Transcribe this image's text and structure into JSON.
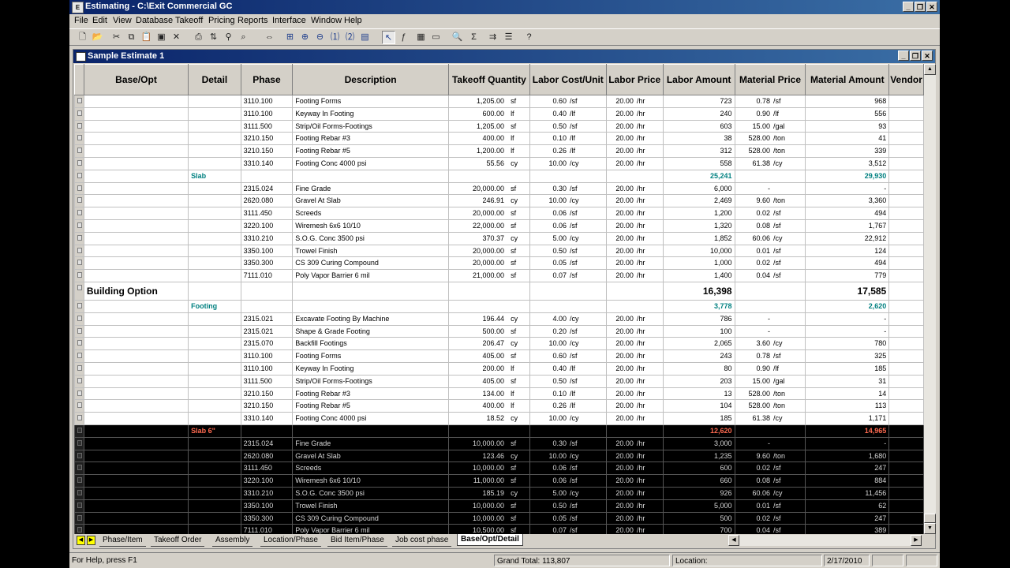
{
  "app": {
    "title": "Estimating - C:\\Exit Commercial GC",
    "icon_text": "E"
  },
  "window_buttons": {
    "minimize": "_",
    "restore": "❐",
    "close": "✕"
  },
  "menu": [
    "File",
    "Edit",
    "View",
    "Database",
    "Takeoff",
    "Pricing",
    "Reports",
    "Interface",
    "Window",
    "Help"
  ],
  "toolbar_icons": [
    "new-file-icon",
    "open-folder-icon",
    "cut-icon",
    "copy-icon",
    "paste-icon",
    "paste-special-icon",
    "delete-icon",
    "print-icon",
    "sort-icon",
    "filter-icon",
    "find-icon",
    "column-resize-icon",
    "insert-icon",
    "expand-icon",
    "collapse-icon",
    "level-1-icon",
    "level-2-icon",
    "totals-icon",
    "select-icon",
    "formula-icon",
    "grid-icon",
    "spreadsheet-icon",
    "zoom-icon",
    "sum-icon",
    "goto-icon",
    "sort-levels-icon",
    "help-pointer-icon"
  ],
  "document": {
    "title": "Sample Estimate 1"
  },
  "columns": [
    "",
    "Base/Opt",
    "Detail",
    "Phase",
    "Description",
    "Takeoff Quantity",
    "Labor Cost/Unit",
    "Labor Price",
    "Labor Amount",
    "Material Price",
    "Material Amount",
    "Vendor"
  ],
  "rows": [
    {
      "type": "item",
      "phase": "3110.100",
      "desc": "Footing Forms",
      "qty": "1,205.00",
      "qty_u": "sf",
      "lcu": "0.60",
      "lcu_u": "/sf",
      "lp": "20.00",
      "lp_u": "/hr",
      "la": "723",
      "mp": "0.78",
      "mp_u": "/sf",
      "ma": "968"
    },
    {
      "type": "item",
      "phase": "3110.100",
      "desc": "Keyway In Footing",
      "qty": "600.00",
      "qty_u": "lf",
      "lcu": "0.40",
      "lcu_u": "/lf",
      "lp": "20.00",
      "lp_u": "/hr",
      "la": "240",
      "mp": "0.90",
      "mp_u": "/lf",
      "ma": "556"
    },
    {
      "type": "item",
      "phase": "3111.500",
      "desc": "Strip/Oil Forms-Footings",
      "qty": "1,205.00",
      "qty_u": "sf",
      "lcu": "0.50",
      "lcu_u": "/sf",
      "lp": "20.00",
      "lp_u": "/hr",
      "la": "603",
      "mp": "15.00",
      "mp_u": "/gal",
      "ma": "93"
    },
    {
      "type": "item",
      "phase": "3210.150",
      "desc": "Footing Rebar #3",
      "qty": "400.00",
      "qty_u": "lf",
      "lcu": "0.10",
      "lcu_u": "/lf",
      "lp": "20.00",
      "lp_u": "/hr",
      "la": "38",
      "mp": "528.00",
      "mp_u": "/ton",
      "ma": "41"
    },
    {
      "type": "item",
      "phase": "3210.150",
      "desc": "Footing Rebar #5",
      "qty": "1,200.00",
      "qty_u": "lf",
      "lcu": "0.26",
      "lcu_u": "/lf",
      "lp": "20.00",
      "lp_u": "/hr",
      "la": "312",
      "mp": "528.00",
      "mp_u": "/ton",
      "ma": "339"
    },
    {
      "type": "item",
      "phase": "3310.140",
      "desc": "Footing Conc 4000 psi",
      "qty": "55.56",
      "qty_u": "cy",
      "lcu": "10.00",
      "lcu_u": "/cy",
      "lp": "20.00",
      "lp_u": "/hr",
      "la": "558",
      "mp": "61.38",
      "mp_u": "/cy",
      "ma": "3,512"
    },
    {
      "type": "group",
      "label": "Slab",
      "la": "25,241",
      "ma": "29,930"
    },
    {
      "type": "item",
      "phase": "2315.024",
      "desc": "Fine Grade",
      "qty": "20,000.00",
      "qty_u": "sf",
      "lcu": "0.30",
      "lcu_u": "/sf",
      "lp": "20.00",
      "lp_u": "/hr",
      "la": "6,000",
      "mp": "-",
      "mp_u": "",
      "ma": "-"
    },
    {
      "type": "item",
      "phase": "2620.080",
      "desc": "Gravel At Slab",
      "qty": "246.91",
      "qty_u": "cy",
      "lcu": "10.00",
      "lcu_u": "/cy",
      "lp": "20.00",
      "lp_u": "/hr",
      "la": "2,469",
      "mp": "9.60",
      "mp_u": "/ton",
      "ma": "3,360"
    },
    {
      "type": "item",
      "phase": "3111.450",
      "desc": "Screeds",
      "qty": "20,000.00",
      "qty_u": "sf",
      "lcu": "0.06",
      "lcu_u": "/sf",
      "lp": "20.00",
      "lp_u": "/hr",
      "la": "1,200",
      "mp": "0.02",
      "mp_u": "/sf",
      "ma": "494"
    },
    {
      "type": "item",
      "phase": "3220.100",
      "desc": "Wiremesh 6x6 10/10",
      "qty": "22,000.00",
      "qty_u": "sf",
      "lcu": "0.06",
      "lcu_u": "/sf",
      "lp": "20.00",
      "lp_u": "/hr",
      "la": "1,320",
      "mp": "0.08",
      "mp_u": "/sf",
      "ma": "1,767"
    },
    {
      "type": "item",
      "phase": "3310.210",
      "desc": "S.O.G. Conc 3500 psi",
      "qty": "370.37",
      "qty_u": "cy",
      "lcu": "5.00",
      "lcu_u": "/cy",
      "lp": "20.00",
      "lp_u": "/hr",
      "la": "1,852",
      "mp": "60.06",
      "mp_u": "/cy",
      "ma": "22,912"
    },
    {
      "type": "item",
      "phase": "3350.100",
      "desc": "Trowel Finish",
      "qty": "20,000.00",
      "qty_u": "sf",
      "lcu": "0.50",
      "lcu_u": "/sf",
      "lp": "20.00",
      "lp_u": "/hr",
      "la": "10,000",
      "mp": "0.01",
      "mp_u": "/sf",
      "ma": "124"
    },
    {
      "type": "item",
      "phase": "3350.300",
      "desc": "CS 309 Curing Compound",
      "qty": "20,000.00",
      "qty_u": "sf",
      "lcu": "0.05",
      "lcu_u": "/sf",
      "lp": "20.00",
      "lp_u": "/hr",
      "la": "1,000",
      "mp": "0.02",
      "mp_u": "/sf",
      "ma": "494"
    },
    {
      "type": "item",
      "phase": "7111.010",
      "desc": "Poly Vapor Barrier 6 mil",
      "qty": "21,000.00",
      "qty_u": "sf",
      "lcu": "0.07",
      "lcu_u": "/sf",
      "lp": "20.00",
      "lp_u": "/hr",
      "la": "1,400",
      "mp": "0.04",
      "mp_u": "/sf",
      "ma": "779"
    },
    {
      "type": "option",
      "label": "Building Option",
      "la": "16,398",
      "ma": "17,585"
    },
    {
      "type": "group",
      "label": "Footing",
      "la": "3,778",
      "ma": "2,620"
    },
    {
      "type": "item",
      "phase": "2315.021",
      "desc": "Excavate Footing By Machine",
      "qty": "196.44",
      "qty_u": "cy",
      "lcu": "4.00",
      "lcu_u": "/cy",
      "lp": "20.00",
      "lp_u": "/hr",
      "la": "786",
      "mp": "-",
      "mp_u": "",
      "ma": "-"
    },
    {
      "type": "item",
      "phase": "2315.021",
      "desc": "Shape & Grade Footing",
      "qty": "500.00",
      "qty_u": "sf",
      "lcu": "0.20",
      "lcu_u": "/sf",
      "lp": "20.00",
      "lp_u": "/hr",
      "la": "100",
      "mp": "-",
      "mp_u": "",
      "ma": "-"
    },
    {
      "type": "item",
      "phase": "2315.070",
      "desc": "Backfill Footings",
      "qty": "206.47",
      "qty_u": "cy",
      "lcu": "10.00",
      "lcu_u": "/cy",
      "lp": "20.00",
      "lp_u": "/hr",
      "la": "2,065",
      "mp": "3.60",
      "mp_u": "/cy",
      "ma": "780"
    },
    {
      "type": "item",
      "phase": "3110.100",
      "desc": "Footing Forms",
      "qty": "405.00",
      "qty_u": "sf",
      "lcu": "0.60",
      "lcu_u": "/sf",
      "lp": "20.00",
      "lp_u": "/hr",
      "la": "243",
      "mp": "0.78",
      "mp_u": "/sf",
      "ma": "325"
    },
    {
      "type": "item",
      "phase": "3110.100",
      "desc": "Keyway In Footing",
      "qty": "200.00",
      "qty_u": "lf",
      "lcu": "0.40",
      "lcu_u": "/lf",
      "lp": "20.00",
      "lp_u": "/hr",
      "la": "80",
      "mp": "0.90",
      "mp_u": "/lf",
      "ma": "185"
    },
    {
      "type": "item",
      "phase": "3111.500",
      "desc": "Strip/Oil Forms-Footings",
      "qty": "405.00",
      "qty_u": "sf",
      "lcu": "0.50",
      "lcu_u": "/sf",
      "lp": "20.00",
      "lp_u": "/hr",
      "la": "203",
      "mp": "15.00",
      "mp_u": "/gal",
      "ma": "31"
    },
    {
      "type": "item",
      "phase": "3210.150",
      "desc": "Footing Rebar #3",
      "qty": "134.00",
      "qty_u": "lf",
      "lcu": "0.10",
      "lcu_u": "/lf",
      "lp": "20.00",
      "lp_u": "/hr",
      "la": "13",
      "mp": "528.00",
      "mp_u": "/ton",
      "ma": "14"
    },
    {
      "type": "item",
      "phase": "3210.150",
      "desc": "Footing Rebar #5",
      "qty": "400.00",
      "qty_u": "lf",
      "lcu": "0.26",
      "lcu_u": "/lf",
      "lp": "20.00",
      "lp_u": "/hr",
      "la": "104",
      "mp": "528.00",
      "mp_u": "/ton",
      "ma": "113"
    },
    {
      "type": "item",
      "phase": "3310.140",
      "desc": "Footing Conc 4000 psi",
      "qty": "18.52",
      "qty_u": "cy",
      "lcu": "10.00",
      "lcu_u": "/cy",
      "lp": "20.00",
      "lp_u": "/hr",
      "la": "185",
      "mp": "61.38",
      "mp_u": "/cy",
      "ma": "1,171"
    },
    {
      "type": "group",
      "dark": true,
      "label": "Slab 6\"",
      "la": "12,620",
      "ma": "14,965"
    },
    {
      "type": "item",
      "dark": true,
      "phase": "2315.024",
      "desc": "Fine Grade",
      "qty": "10,000.00",
      "qty_u": "sf",
      "lcu": "0.30",
      "lcu_u": "/sf",
      "lp": "20.00",
      "lp_u": "/hr",
      "la": "3,000",
      "mp": "-",
      "mp_u": "",
      "ma": "-"
    },
    {
      "type": "item",
      "dark": true,
      "phase": "2620.080",
      "desc": "Gravel At Slab",
      "qty": "123.46",
      "qty_u": "cy",
      "lcu": "10.00",
      "lcu_u": "/cy",
      "lp": "20.00",
      "lp_u": "/hr",
      "la": "1,235",
      "mp": "9.60",
      "mp_u": "/ton",
      "ma": "1,680"
    },
    {
      "type": "item",
      "dark": true,
      "phase": "3111.450",
      "desc": "Screeds",
      "qty": "10,000.00",
      "qty_u": "sf",
      "lcu": "0.06",
      "lcu_u": "/sf",
      "lp": "20.00",
      "lp_u": "/hr",
      "la": "600",
      "mp": "0.02",
      "mp_u": "/sf",
      "ma": "247"
    },
    {
      "type": "item",
      "dark": true,
      "phase": "3220.100",
      "desc": "Wiremesh 6x6 10/10",
      "qty": "11,000.00",
      "qty_u": "sf",
      "lcu": "0.06",
      "lcu_u": "/sf",
      "lp": "20.00",
      "lp_u": "/hr",
      "la": "660",
      "mp": "0.08",
      "mp_u": "/sf",
      "ma": "884"
    },
    {
      "type": "item",
      "dark": true,
      "phase": "3310.210",
      "desc": "S.O.G. Conc 3500 psi",
      "qty": "185.19",
      "qty_u": "cy",
      "lcu": "5.00",
      "lcu_u": "/cy",
      "lp": "20.00",
      "lp_u": "/hr",
      "la": "926",
      "mp": "60.06",
      "mp_u": "/cy",
      "ma": "11,456"
    },
    {
      "type": "item",
      "dark": true,
      "phase": "3350.100",
      "desc": "Trowel Finish",
      "qty": "10,000.00",
      "qty_u": "sf",
      "lcu": "0.50",
      "lcu_u": "/sf",
      "lp": "20.00",
      "lp_u": "/hr",
      "la": "5,000",
      "mp": "0.01",
      "mp_u": "/sf",
      "ma": "62"
    },
    {
      "type": "item",
      "dark": true,
      "phase": "3350.300",
      "desc": "CS 309 Curing Compound",
      "qty": "10,000.00",
      "qty_u": "sf",
      "lcu": "0.05",
      "lcu_u": "/sf",
      "lp": "20.00",
      "lp_u": "/hr",
      "la": "500",
      "mp": "0.02",
      "mp_u": "/sf",
      "ma": "247"
    },
    {
      "type": "item",
      "dark": true,
      "phase": "7111.010",
      "desc": "Poly Vapor Barrier 6 mil",
      "qty": "10,500.00",
      "qty_u": "sf",
      "lcu": "0.07",
      "lcu_u": "/sf",
      "lp": "20.00",
      "lp_u": "/hr",
      "la": "700",
      "mp": "0.04",
      "mp_u": "/sf",
      "ma": "389"
    }
  ],
  "tabs": [
    {
      "label": "Phase/Item",
      "active": false
    },
    {
      "label": "Takeoff Order",
      "active": false
    },
    {
      "label": "Assembly",
      "active": false
    },
    {
      "label": "Location/Phase",
      "active": false
    },
    {
      "label": "Bid Item/Phase",
      "active": false
    },
    {
      "label": "Job cost phase",
      "active": false
    },
    {
      "label": "Base/Opt/Detail",
      "active": true
    }
  ],
  "status": {
    "help": "For Help, press F1",
    "grand_total": "Grand Total: 113,807",
    "location": "Location:",
    "date": "2/17/2010"
  },
  "colors": {
    "title_bar": "#0a246a",
    "group_text": "#008080",
    "dark_group_text": "#ff6a50"
  }
}
